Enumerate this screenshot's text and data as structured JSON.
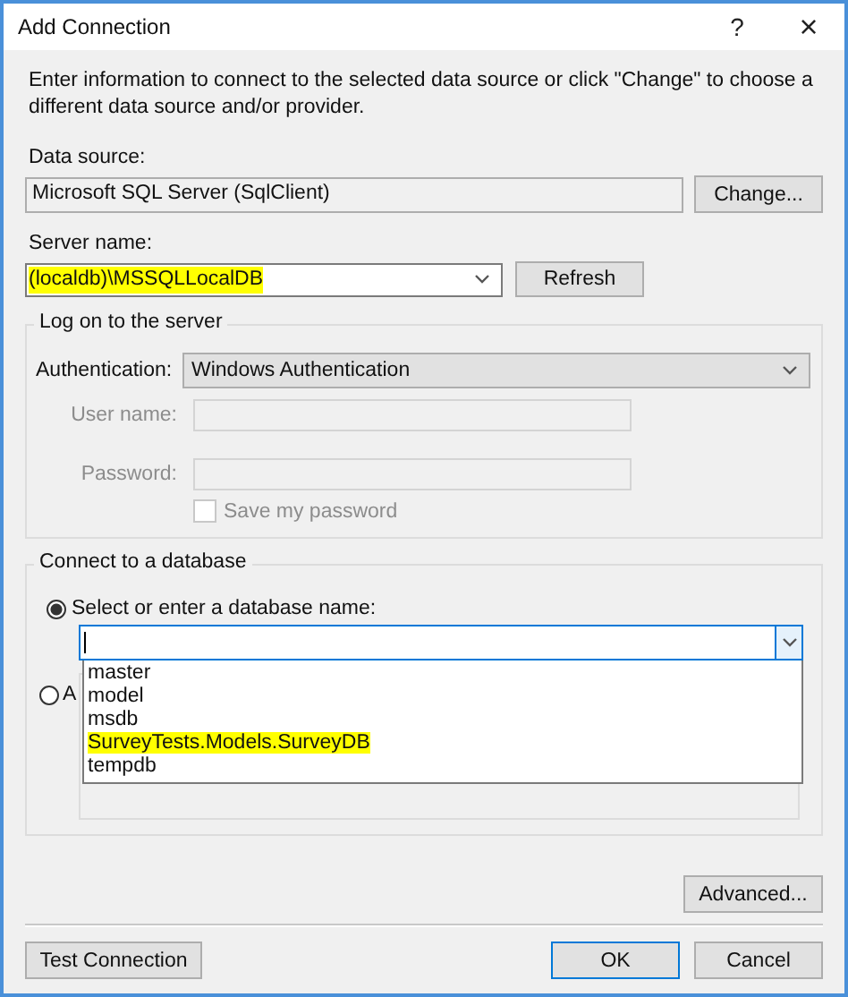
{
  "window": {
    "title": "Add Connection",
    "help": "?",
    "close": "×"
  },
  "intro": "Enter information to connect to the selected data source or click \"Change\" to choose a different data source and/or provider.",
  "data_source": {
    "label": "Data source:",
    "value": "Microsoft SQL Server (SqlClient)",
    "button": "Change..."
  },
  "server": {
    "label": "Server name:",
    "value": "(localdb)\\MSSQLLocalDB",
    "highlighted": true,
    "button": "Refresh"
  },
  "logon": {
    "title": "Log on to the server",
    "auth_label": "Authentication:",
    "auth_value": "Windows Authentication",
    "user_label": "User name:",
    "password_label": "Password:",
    "save_password": {
      "label": "Save my password",
      "checked": false,
      "disabled": true
    },
    "disabled": true
  },
  "database": {
    "title": "Connect to a database",
    "options": [
      {
        "label": "Select or enter a database name:",
        "selected": true
      },
      {
        "label": "A",
        "selected": false
      }
    ],
    "list": [
      {
        "label": "master",
        "highlighted": false
      },
      {
        "label": "model",
        "highlighted": false
      },
      {
        "label": "msdb",
        "highlighted": false
      },
      {
        "label": "SurveyTests.Models.SurveyDB",
        "highlighted": true
      },
      {
        "label": "tempdb",
        "highlighted": false
      }
    ]
  },
  "buttons": {
    "advanced": "Advanced...",
    "test": "Test Connection",
    "ok": "OK",
    "cancel": "Cancel"
  }
}
